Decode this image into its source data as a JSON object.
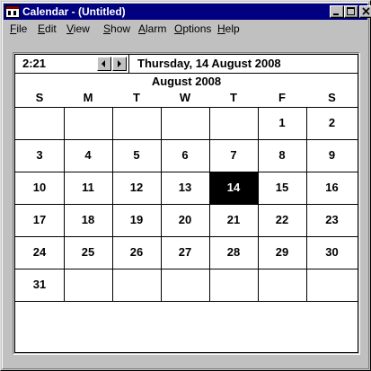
{
  "window": {
    "title": "Calendar - (Untitled)"
  },
  "menu": [
    "File",
    "Edit",
    "View",
    "Show",
    "Alarm",
    "Options",
    "Help"
  ],
  "menu_hotkeys": [
    "F",
    "E",
    "V",
    "S",
    "A",
    "O",
    "H"
  ],
  "time": "2:21",
  "date_long": "Thursday, 14 August 2008",
  "month_title": "August 2008",
  "weekdays": [
    "S",
    "M",
    "T",
    "W",
    "T",
    "F",
    "S"
  ],
  "selected_day": 14,
  "weeks": [
    [
      "",
      "",
      "",
      "",
      "",
      "1",
      "2"
    ],
    [
      "3",
      "4",
      "5",
      "6",
      "7",
      "8",
      "9"
    ],
    [
      "10",
      "11",
      "12",
      "13",
      "14",
      "15",
      "16"
    ],
    [
      "17",
      "18",
      "19",
      "20",
      "21",
      "22",
      "23"
    ],
    [
      "24",
      "25",
      "26",
      "27",
      "28",
      "29",
      "30"
    ],
    [
      "31",
      "",
      "",
      "",
      "",
      "",
      ""
    ]
  ],
  "colors": {
    "titlebar": "#000080",
    "face": "#c0c0c0",
    "selected_bg": "#000000"
  }
}
